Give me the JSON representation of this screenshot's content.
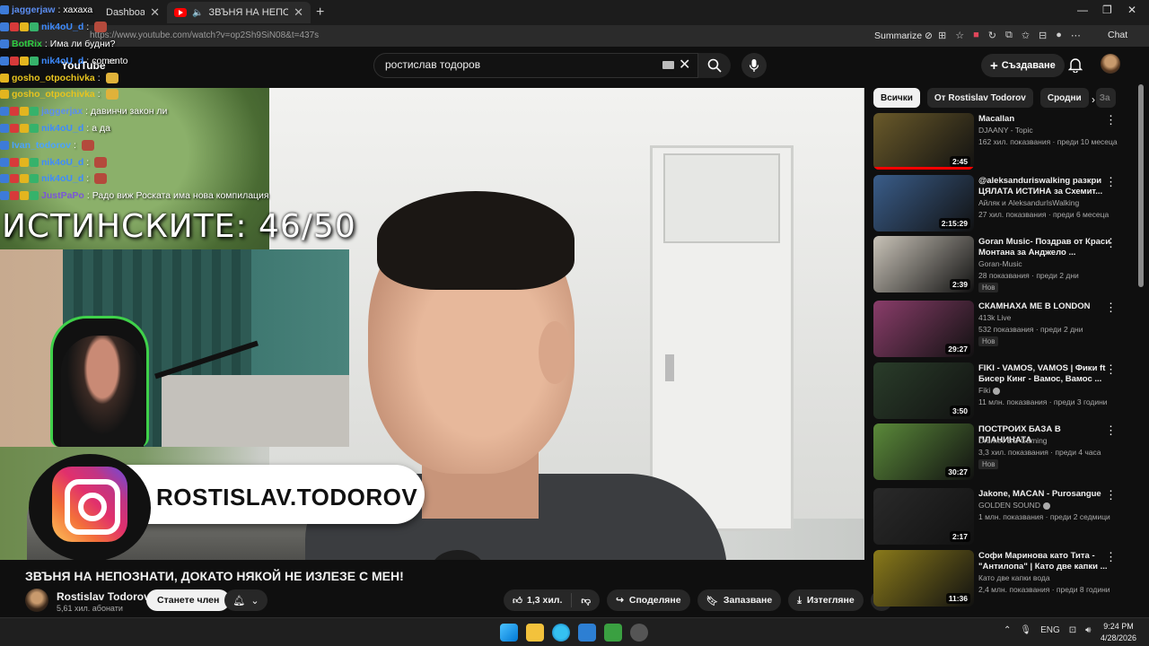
{
  "browser": {
    "tabs": [
      {
        "label": "Dashboard",
        "active": false
      },
      {
        "label": "ЗВЪНЯ НА НЕПОЗНАТИ, ДОКА",
        "active": true
      }
    ],
    "url": "https://www.youtube.com/watch?v=op2Sh9SiN08&t=437s",
    "summarize_label": "Summarize",
    "chat_label": "Chat"
  },
  "youtube": {
    "logo_text": "YouTube",
    "logo_region": "BG",
    "search_value": "ростислав тодоров",
    "create_label": "Създаване"
  },
  "video": {
    "title": "ЗВЪНЯ НА НЕПОЗНАТИ, ДОКАТО НЯКОЙ НЕ ИЗЛЕЗЕ С МЕН!",
    "overlay_counter": "ИСТИНСКИТЕ: 46/50",
    "instagram_handle": "ROSTISLAV.TODOROV",
    "channel_name": "Rostislav Todorov",
    "channel_subs": "5,61 хил. абонати",
    "join_label": "Станете член",
    "likes": "1,3 хил.",
    "share_label": "Споделяне",
    "save_label": "Запазване",
    "download_label": "Изтегляне"
  },
  "chat": [
    {
      "user": "jaggerjaw",
      "color": "#5b8df0",
      "message": "хахаха",
      "badges": [
        "blue"
      ],
      "emote": false
    },
    {
      "user": "nik4oU_d",
      "color": "#3d8bff",
      "message": "",
      "badges": [
        "blue",
        "red",
        "yel",
        "grn"
      ],
      "emote": "r"
    },
    {
      "user": "BotRix",
      "color": "#2ecc40",
      "message": "Има ли будни?",
      "badges": [
        "blue"
      ],
      "emote": false
    },
    {
      "user": "nik4oU_d",
      "color": "#3d8bff",
      "message": "comento",
      "badges": [
        "blue",
        "red",
        "yel",
        "grn"
      ],
      "emote": false
    },
    {
      "user": "gosho_otpochivka",
      "color": "#e6c31f",
      "message": "",
      "badges": [
        "yel"
      ],
      "emote": "y"
    },
    {
      "user": "gosho_otpochivka",
      "color": "#e6c31f",
      "message": "",
      "badges": [
        "yel"
      ],
      "emote": "y"
    },
    {
      "user": "jaggerjax",
      "color": "#5b8df0",
      "message": "давинчи закон ли",
      "badges": [
        "blue",
        "red",
        "yel",
        "grn"
      ],
      "emote": false
    },
    {
      "user": "nik4oU_d",
      "color": "#3d8bff",
      "message": "а да",
      "badges": [
        "blue",
        "red",
        "yel",
        "grn"
      ],
      "emote": false
    },
    {
      "user": "Ivan_todorov",
      "color": "#4aa3ff",
      "message": "",
      "badges": [
        "blue"
      ],
      "emote": "r"
    },
    {
      "user": "nik4oU_d",
      "color": "#3d8bff",
      "message": "",
      "badges": [
        "blue",
        "red",
        "yel",
        "grn"
      ],
      "emote": "r"
    },
    {
      "user": "nik4oU_d",
      "color": "#3d8bff",
      "message": "",
      "badges": [
        "blue",
        "red",
        "yel",
        "grn"
      ],
      "emote": "r"
    },
    {
      "user": "JustPaPo",
      "color": "#7a56d8",
      "message": "Радо виж Роската има нова компилация",
      "badges": [
        "blue",
        "red",
        "yel",
        "grn"
      ],
      "emote": false
    }
  ],
  "chips": [
    "Всички",
    "От Rostislav Todorov",
    "Сродни",
    "За"
  ],
  "recommendations": [
    {
      "title": "Macallan",
      "channel": "DJAANY - Topic",
      "meta": "162 хил. показвания · преди 10 месеца",
      "duration": "2:45",
      "badge": "",
      "verified": false,
      "music": true,
      "thumb": "#6a5a2a",
      "progress": true
    },
    {
      "title": "@aleksanduriswalking разкри ЦЯЛАТА ИСТИНА за Схемит...",
      "channel": "Айляк и AleksandurIsWalking",
      "meta": "27 хил. показвания · преди 6 месеца",
      "duration": "2:15:29",
      "badge": "",
      "verified": false,
      "music": false,
      "thumb": "#3a5d8a",
      "progress": false
    },
    {
      "title": "Goran Music- Поздрав от Краси Монтана за Анджело ...",
      "channel": "Goran-Music",
      "meta": "28 показвания · преди 2 дни",
      "duration": "2:39",
      "badge": "Нов",
      "verified": false,
      "music": true,
      "thumb": "#c9c3b8",
      "progress": false
    },
    {
      "title": "СКАМНАХА МЕ В LONDON",
      "channel": "413k Live",
      "meta": "532 показвания · преди 2 дни",
      "duration": "29:27",
      "badge": "Нов",
      "verified": false,
      "music": false,
      "thumb": "#8a3d6a",
      "progress": false
    },
    {
      "title": "FIKI - VAMOS, VAMOS | Фики ft Бисер Кинг - Вамос, Вамос ...",
      "channel": "Fiki",
      "meta": "11 млн. показвания · преди 3 години",
      "duration": "3:50",
      "badge": "",
      "verified": true,
      "music": true,
      "thumb": "#2a3d2a",
      "progress": false
    },
    {
      "title": "ПОСТРОИХ БАЗА В ПЛАНИНАТА",
      "channel": "Drumev BG Gaming",
      "meta": "3,3 хил. показвания · преди 4 часа",
      "duration": "30:27",
      "badge": "Нов",
      "verified": false,
      "music": false,
      "thumb": "#5b8a3a",
      "progress": false
    },
    {
      "title": "Jakone, MACAN - Purosangue",
      "channel": "GOLDEN SOUND",
      "meta": "1 млн. показвания · преди 2 седмици",
      "duration": "2:17",
      "badge": "",
      "verified": true,
      "music": true,
      "thumb": "#2a2a2a",
      "progress": false
    },
    {
      "title": "Софи Маринова като Тита - \"Антилопа\" | Като две капки ...",
      "channel": "Като две капки вода",
      "meta": "2,4 млн. показвания · преди 8 години",
      "duration": "11:36",
      "badge": "",
      "verified": false,
      "music": false,
      "thumb": "#8a7a1a",
      "progress": false
    }
  ],
  "taskbar": {
    "lang": "ENG",
    "time": "9:24 PM",
    "date": "4/28/2026"
  },
  "colors": {
    "bg": "#0f0f0f",
    "brand_red": "#ff0000",
    "chip_bg": "#272727"
  }
}
